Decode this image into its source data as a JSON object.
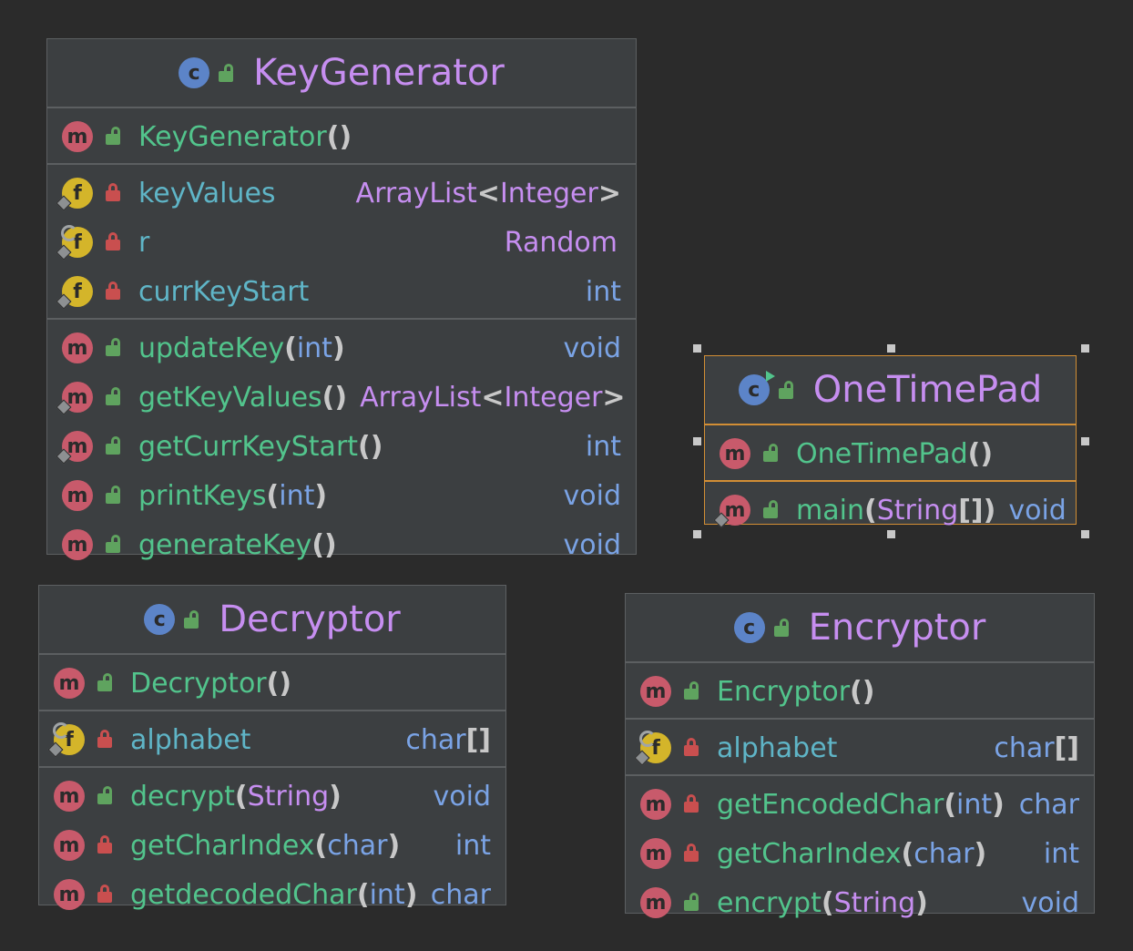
{
  "classes": {
    "keygen": {
      "name": "KeyGenerator",
      "constructor": {
        "name": "KeyGenerator",
        "params": "",
        "paren_open": "(",
        "paren_close": ")"
      },
      "fields": [
        {
          "name": "keyValues",
          "type_main": "ArrayList",
          "lt": "<",
          "type_arg": "Integer",
          "gt": ">"
        },
        {
          "name": "r",
          "type": "Random"
        },
        {
          "name": "currKeyStart",
          "type": "int"
        }
      ],
      "methods": [
        {
          "name": "updateKey",
          "params": "int",
          "ret": "void"
        },
        {
          "name": "getKeyValues",
          "params": "",
          "ret_main": "ArrayList",
          "lt": "<",
          "ret_arg": "Integer",
          "gt": ">"
        },
        {
          "name": "getCurrKeyStart",
          "params": "",
          "ret": "int"
        },
        {
          "name": "printKeys",
          "params": "int",
          "ret": "void"
        },
        {
          "name": "generateKey",
          "params": "",
          "ret": "void"
        }
      ]
    },
    "onetimepad": {
      "name": "OneTimePad",
      "constructor": {
        "name": "OneTimePad",
        "params": ""
      },
      "methods": [
        {
          "name": "main",
          "params": "String",
          "arr": "[]",
          "ret": "void"
        }
      ]
    },
    "decryptor": {
      "name": "Decryptor",
      "constructor": {
        "name": "Decryptor",
        "params": ""
      },
      "fields": [
        {
          "name": "alphabet",
          "type": "char",
          "arr": "[]"
        }
      ],
      "methods": [
        {
          "name": "decrypt",
          "params": "String",
          "ret": "void"
        },
        {
          "name": "getCharIndex",
          "params": "char",
          "ret": "int"
        },
        {
          "name": "getdecodedChar",
          "params": "int",
          "ret": "char"
        }
      ]
    },
    "encryptor": {
      "name": "Encryptor",
      "constructor": {
        "name": "Encryptor",
        "params": ""
      },
      "fields": [
        {
          "name": "alphabet",
          "type": "char",
          "arr": "[]"
        }
      ],
      "methods": [
        {
          "name": "getEncodedChar",
          "params": "int",
          "ret": "char"
        },
        {
          "name": "getCharIndex",
          "params": "char",
          "ret": "int"
        },
        {
          "name": "encrypt",
          "params": "String",
          "ret": "void"
        }
      ]
    }
  },
  "badges": {
    "class": "c",
    "method": "m",
    "field": "f"
  },
  "syntax": {
    "open": "(",
    "close": ")",
    "lt": "<",
    "gt": ">",
    "arr": "[]"
  },
  "colors": {
    "background": "#2b2b2b",
    "box": "#3c3f41",
    "class_name": "#c68ef0",
    "member_name": "#52c48c",
    "field_name": "#5fb5c7",
    "type": "#7aa3e5",
    "selection": "#d28e35"
  }
}
